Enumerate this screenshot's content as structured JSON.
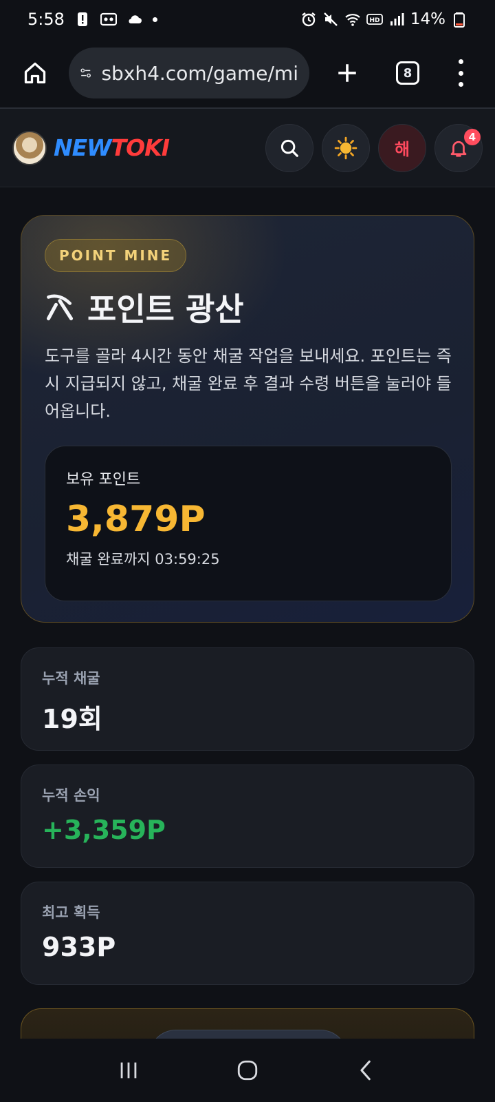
{
  "status_bar": {
    "time": "5:58",
    "battery": "14%"
  },
  "browser": {
    "url": "sbxh4.com/game/mi",
    "tab_count": "8"
  },
  "header": {
    "logo_part1": "NEW",
    "logo_part2": "TOKI",
    "lang_label": "해",
    "notification_count": "4"
  },
  "hero": {
    "chip": "POINT MINE",
    "title": "포인트 광산",
    "description": "도구를 골라 4시간 동안 채굴 작업을 보내세요. 포인트는 즉시 지급되지 않고, 채굴 완료 후 결과 수령 버튼을 눌러야 들어옵니다.",
    "balance_label": "보유 포인트",
    "balance_value": "3,879P",
    "countdown": "채굴 완료까지 03:59:25"
  },
  "stats": [
    {
      "label": "누적 채굴",
      "value": "19회"
    },
    {
      "label": "누적 손익",
      "value": "+3,359P"
    },
    {
      "label": "최고 획득",
      "value": "933P"
    }
  ],
  "colors": {
    "accent_gold": "#f7b733",
    "profit_green": "#27b35a",
    "logo_blue": "#2f8cff",
    "logo_red": "#ff3b3b"
  }
}
